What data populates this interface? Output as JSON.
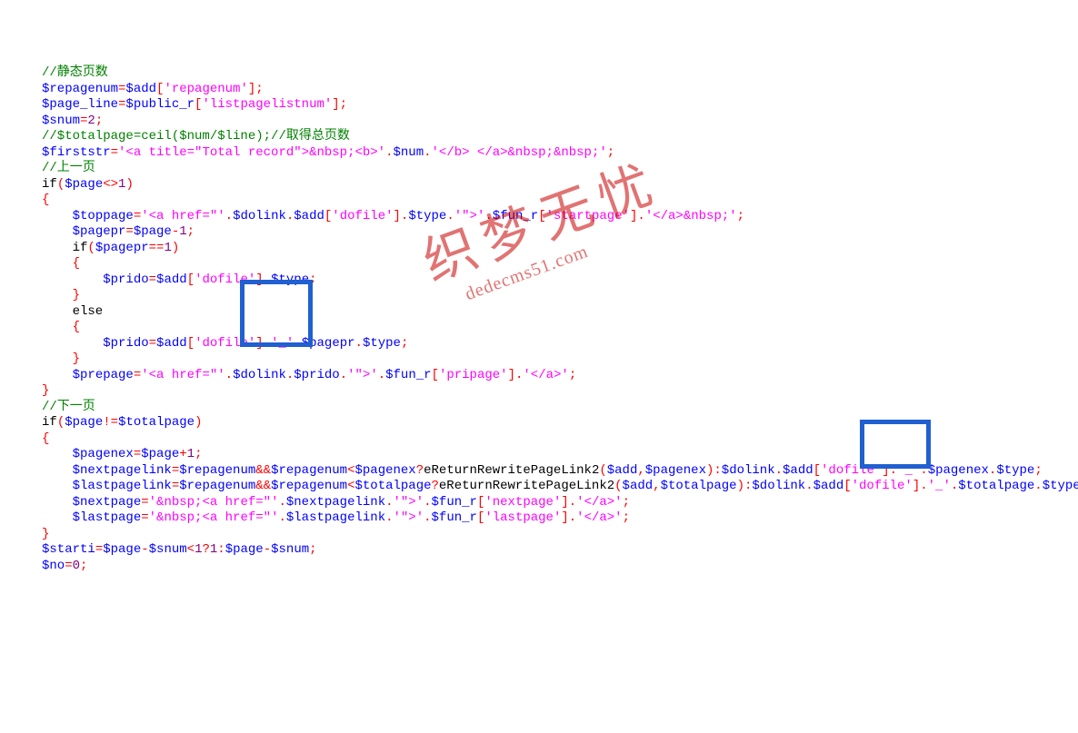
{
  "watermark": {
    "big": "织梦无忧",
    "small": "dedecms51.com"
  },
  "lines": [
    [
      [
        "c-green",
        "//静态页数"
      ]
    ],
    [
      [
        "c-blue",
        "$repagenum"
      ],
      [
        "c-red",
        "="
      ],
      [
        "c-blue",
        "$add"
      ],
      [
        "c-red",
        "["
      ],
      [
        "c-pink",
        "'repagenum'"
      ],
      [
        "c-red",
        "];"
      ]
    ],
    [
      [
        "c-blue",
        "$page_line"
      ],
      [
        "c-red",
        "="
      ],
      [
        "c-blue",
        "$public_r"
      ],
      [
        "c-red",
        "["
      ],
      [
        "c-pink",
        "'listpagelistnum'"
      ],
      [
        "c-red",
        "];"
      ]
    ],
    [
      [
        "c-blue",
        "$snum"
      ],
      [
        "c-red",
        "="
      ],
      [
        "c-purple",
        "2"
      ],
      [
        "c-red",
        ";"
      ]
    ],
    [
      [
        "c-green",
        "//$totalpage=ceil($num/$line);//取得总页数"
      ]
    ],
    [
      [
        "c-blue",
        "$firststr"
      ],
      [
        "c-red",
        "="
      ],
      [
        "c-pink",
        "'<a title=\"Total record\">&nbsp;<b>'"
      ],
      [
        "c-red",
        "."
      ],
      [
        "c-blue",
        "$num"
      ],
      [
        "c-red",
        "."
      ],
      [
        "c-pink",
        "'</b> </a>&nbsp;&nbsp;'"
      ],
      [
        "c-red",
        ";"
      ]
    ],
    [
      [
        "c-green",
        "//上一页"
      ]
    ],
    [
      [
        "c-black",
        "if"
      ],
      [
        "c-red",
        "("
      ],
      [
        "c-blue",
        "$page"
      ],
      [
        "c-red",
        "<>"
      ],
      [
        "c-purple",
        "1"
      ],
      [
        "c-red",
        ")"
      ]
    ],
    [
      [
        "c-red",
        "{"
      ]
    ],
    [
      [
        "c-black",
        "    "
      ],
      [
        "c-blue",
        "$toppage"
      ],
      [
        "c-red",
        "="
      ],
      [
        "c-pink",
        "'<a href=\"'"
      ],
      [
        "c-red",
        "."
      ],
      [
        "c-blue",
        "$dolink"
      ],
      [
        "c-red",
        "."
      ],
      [
        "c-blue",
        "$add"
      ],
      [
        "c-red",
        "["
      ],
      [
        "c-pink",
        "'dofile'"
      ],
      [
        "c-red",
        "]."
      ],
      [
        "c-blue",
        "$type"
      ],
      [
        "c-red",
        "."
      ],
      [
        "c-pink",
        "'\">'"
      ],
      [
        "c-red",
        "."
      ],
      [
        "c-blue",
        "$fun_r"
      ],
      [
        "c-red",
        "["
      ],
      [
        "c-pink",
        "'startpage'"
      ],
      [
        "c-red",
        "]."
      ],
      [
        "c-pink",
        "'</a>&nbsp;'"
      ],
      [
        "c-red",
        ";"
      ]
    ],
    [
      [
        "c-black",
        "    "
      ],
      [
        "c-blue",
        "$pagepr"
      ],
      [
        "c-red",
        "="
      ],
      [
        "c-blue",
        "$page"
      ],
      [
        "c-red",
        "-"
      ],
      [
        "c-purple",
        "1"
      ],
      [
        "c-red",
        ";"
      ]
    ],
    [
      [
        "c-black",
        "    if"
      ],
      [
        "c-red",
        "("
      ],
      [
        "c-blue",
        "$pagepr"
      ],
      [
        "c-red",
        "=="
      ],
      [
        "c-purple",
        "1"
      ],
      [
        "c-red",
        ")"
      ]
    ],
    [
      [
        "c-black",
        "    "
      ],
      [
        "c-red",
        "{"
      ]
    ],
    [
      [
        "c-black",
        "        "
      ],
      [
        "c-blue",
        "$prido"
      ],
      [
        "c-red",
        "="
      ],
      [
        "c-blue",
        "$add"
      ],
      [
        "c-red",
        "["
      ],
      [
        "c-pink",
        "'dofile'"
      ],
      [
        "c-red",
        "]."
      ],
      [
        "c-blue",
        "$type"
      ],
      [
        "c-red",
        ";"
      ]
    ],
    [
      [
        "c-black",
        "    "
      ],
      [
        "c-red",
        "}"
      ]
    ],
    [
      [
        "c-black",
        "    else"
      ]
    ],
    [
      [
        "c-black",
        "    "
      ],
      [
        "c-red",
        "{"
      ]
    ],
    [
      [
        "c-black",
        "        "
      ],
      [
        "c-blue",
        "$prido"
      ],
      [
        "c-red",
        "="
      ],
      [
        "c-blue",
        "$add"
      ],
      [
        "c-red",
        "["
      ],
      [
        "c-pink",
        "'dofile'"
      ],
      [
        "c-red",
        "]."
      ],
      [
        "c-pink",
        "'_'"
      ],
      [
        "c-red",
        "."
      ],
      [
        "c-blue",
        "$pagepr"
      ],
      [
        "c-red",
        "."
      ],
      [
        "c-blue",
        "$type"
      ],
      [
        "c-red",
        ";"
      ]
    ],
    [
      [
        "c-black",
        "    "
      ],
      [
        "c-red",
        "}"
      ]
    ],
    [
      [
        "c-black",
        "    "
      ],
      [
        "c-blue",
        "$prepage"
      ],
      [
        "c-red",
        "="
      ],
      [
        "c-pink",
        "'<a href=\"'"
      ],
      [
        "c-red",
        "."
      ],
      [
        "c-blue",
        "$dolink"
      ],
      [
        "c-red",
        "."
      ],
      [
        "c-blue",
        "$prido"
      ],
      [
        "c-red",
        "."
      ],
      [
        "c-pink",
        "'\">'"
      ],
      [
        "c-red",
        "."
      ],
      [
        "c-blue",
        "$fun_r"
      ],
      [
        "c-red",
        "["
      ],
      [
        "c-pink",
        "'pripage'"
      ],
      [
        "c-red",
        "]."
      ],
      [
        "c-pink",
        "'</a>'"
      ],
      [
        "c-red",
        ";"
      ]
    ],
    [
      [
        "c-red",
        "}"
      ]
    ],
    [
      [
        "c-green",
        "//下一页"
      ]
    ],
    [
      [
        "c-black",
        "if"
      ],
      [
        "c-red",
        "("
      ],
      [
        "c-blue",
        "$page"
      ],
      [
        "c-red",
        "!="
      ],
      [
        "c-blue",
        "$totalpage"
      ],
      [
        "c-red",
        ")"
      ]
    ],
    [
      [
        "c-red",
        "{"
      ]
    ],
    [
      [
        "c-black",
        "    "
      ],
      [
        "c-blue",
        "$pagenex"
      ],
      [
        "c-red",
        "="
      ],
      [
        "c-blue",
        "$page"
      ],
      [
        "c-red",
        "+"
      ],
      [
        "c-purple",
        "1"
      ],
      [
        "c-red",
        ";"
      ]
    ],
    [
      [
        "c-black",
        "    "
      ],
      [
        "c-blue",
        "$nextpagelink"
      ],
      [
        "c-red",
        "="
      ],
      [
        "c-blue",
        "$repagenum"
      ],
      [
        "c-red",
        "&&"
      ],
      [
        "c-blue",
        "$repagenum"
      ],
      [
        "c-red",
        "<"
      ],
      [
        "c-blue",
        "$pagenex"
      ],
      [
        "c-red",
        "?"
      ],
      [
        "c-black",
        "eReturnRewritePageLink2"
      ],
      [
        "c-red",
        "("
      ],
      [
        "c-blue",
        "$add"
      ],
      [
        "c-red",
        ","
      ],
      [
        "c-blue",
        "$pagenex"
      ],
      [
        "c-red",
        "):"
      ],
      [
        "c-blue",
        "$dolink"
      ],
      [
        "c-red",
        "."
      ],
      [
        "c-blue",
        "$add"
      ],
      [
        "c-red",
        "["
      ],
      [
        "c-pink",
        "'dofile'"
      ],
      [
        "c-red",
        "]."
      ],
      [
        "c-pink",
        "'_'"
      ],
      [
        "c-red",
        "."
      ],
      [
        "c-blue",
        "$pagenex"
      ],
      [
        "c-red",
        "."
      ],
      [
        "c-blue",
        "$type"
      ],
      [
        "c-red",
        ";"
      ]
    ],
    [
      [
        "c-black",
        "    "
      ],
      [
        "c-blue",
        "$lastpagelink"
      ],
      [
        "c-red",
        "="
      ],
      [
        "c-blue",
        "$repagenum"
      ],
      [
        "c-red",
        "&&"
      ],
      [
        "c-blue",
        "$repagenum"
      ],
      [
        "c-red",
        "<"
      ],
      [
        "c-blue",
        "$totalpage"
      ],
      [
        "c-red",
        "?"
      ],
      [
        "c-black",
        "eReturnRewritePageLink2"
      ],
      [
        "c-red",
        "("
      ],
      [
        "c-blue",
        "$add"
      ],
      [
        "c-red",
        ","
      ],
      [
        "c-blue",
        "$totalpage"
      ],
      [
        "c-red",
        "):"
      ],
      [
        "c-blue",
        "$dolink"
      ],
      [
        "c-red",
        "."
      ],
      [
        "c-blue",
        "$add"
      ],
      [
        "c-red",
        "["
      ],
      [
        "c-pink",
        "'dofile'"
      ],
      [
        "c-red",
        "]."
      ],
      [
        "c-pink",
        "'_'"
      ],
      [
        "c-red",
        "."
      ],
      [
        "c-blue",
        "$totalpage"
      ],
      [
        "c-red",
        "."
      ],
      [
        "c-blue",
        "$type"
      ],
      [
        "c-red",
        ";"
      ]
    ],
    [
      [
        "c-black",
        "    "
      ],
      [
        "c-blue",
        "$nextpage"
      ],
      [
        "c-red",
        "="
      ],
      [
        "c-pink",
        "'&nbsp;<a href=\"'"
      ],
      [
        "c-red",
        "."
      ],
      [
        "c-blue",
        "$nextpagelink"
      ],
      [
        "c-red",
        "."
      ],
      [
        "c-pink",
        "'\">'"
      ],
      [
        "c-red",
        "."
      ],
      [
        "c-blue",
        "$fun_r"
      ],
      [
        "c-red",
        "["
      ],
      [
        "c-pink",
        "'nextpage'"
      ],
      [
        "c-red",
        "]."
      ],
      [
        "c-pink",
        "'</a>'"
      ],
      [
        "c-red",
        ";"
      ]
    ],
    [
      [
        "c-black",
        "    "
      ],
      [
        "c-blue",
        "$lastpage"
      ],
      [
        "c-red",
        "="
      ],
      [
        "c-pink",
        "'&nbsp;<a href=\"'"
      ],
      [
        "c-red",
        "."
      ],
      [
        "c-blue",
        "$lastpagelink"
      ],
      [
        "c-red",
        "."
      ],
      [
        "c-pink",
        "'\">'"
      ],
      [
        "c-red",
        "."
      ],
      [
        "c-blue",
        "$fun_r"
      ],
      [
        "c-red",
        "["
      ],
      [
        "c-pink",
        "'lastpage'"
      ],
      [
        "c-red",
        "]."
      ],
      [
        "c-pink",
        "'</a>'"
      ],
      [
        "c-red",
        ";"
      ]
    ],
    [
      [
        "c-red",
        "}"
      ]
    ],
    [
      [
        "c-blue",
        "$starti"
      ],
      [
        "c-red",
        "="
      ],
      [
        "c-blue",
        "$page"
      ],
      [
        "c-red",
        "-"
      ],
      [
        "c-blue",
        "$snum"
      ],
      [
        "c-red",
        "<"
      ],
      [
        "c-purple",
        "1"
      ],
      [
        "c-red",
        "?"
      ],
      [
        "c-purple",
        "1"
      ],
      [
        "c-red",
        ":"
      ],
      [
        "c-blue",
        "$page"
      ],
      [
        "c-red",
        "-"
      ],
      [
        "c-blue",
        "$snum"
      ],
      [
        "c-red",
        ";"
      ]
    ],
    [
      [
        "c-blue",
        "$no"
      ],
      [
        "c-red",
        "="
      ],
      [
        "c-purple",
        "0"
      ],
      [
        "c-red",
        ";"
      ]
    ]
  ]
}
